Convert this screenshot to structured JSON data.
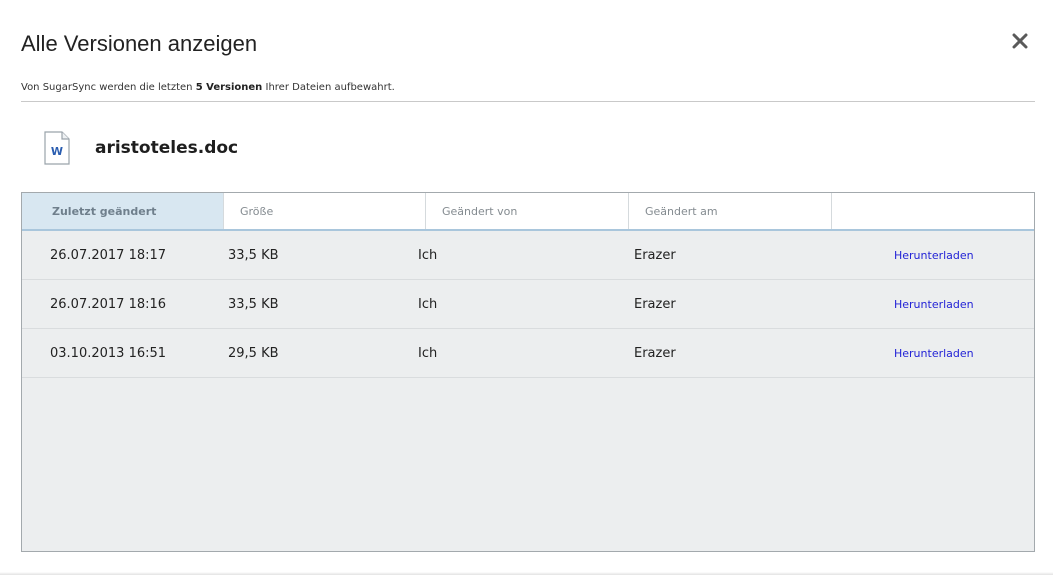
{
  "dialog": {
    "title": "Alle Versionen anzeigen",
    "subtitle_prefix": "Von SugarSync werden die letzten ",
    "subtitle_bold": "5 Versionen",
    "subtitle_suffix": " Ihrer Dateien aufbewahrt."
  },
  "file": {
    "name": "aristoteles.doc",
    "icon_letter": "W"
  },
  "table": {
    "headers": [
      "Zuletzt geändert",
      "Größe",
      "Geändert von",
      "Geändert am",
      ""
    ],
    "rows": [
      {
        "modified": "26.07.2017 18:17",
        "size": "33,5 KB",
        "changed_by": "Ich",
        "changed_on": "Erazer",
        "action": "Herunterladen"
      },
      {
        "modified": "26.07.2017 18:16",
        "size": "33,5 KB",
        "changed_by": "Ich",
        "changed_on": "Erazer",
        "action": "Herunterladen"
      },
      {
        "modified": "03.10.2013 16:51",
        "size": "29,5 KB",
        "changed_by": "Ich",
        "changed_on": "Erazer",
        "action": "Herunterladen"
      }
    ]
  },
  "colors": {
    "link": "#2323d6",
    "active_header_bg": "#d8e7f1",
    "table_bg": "#eceeef"
  }
}
